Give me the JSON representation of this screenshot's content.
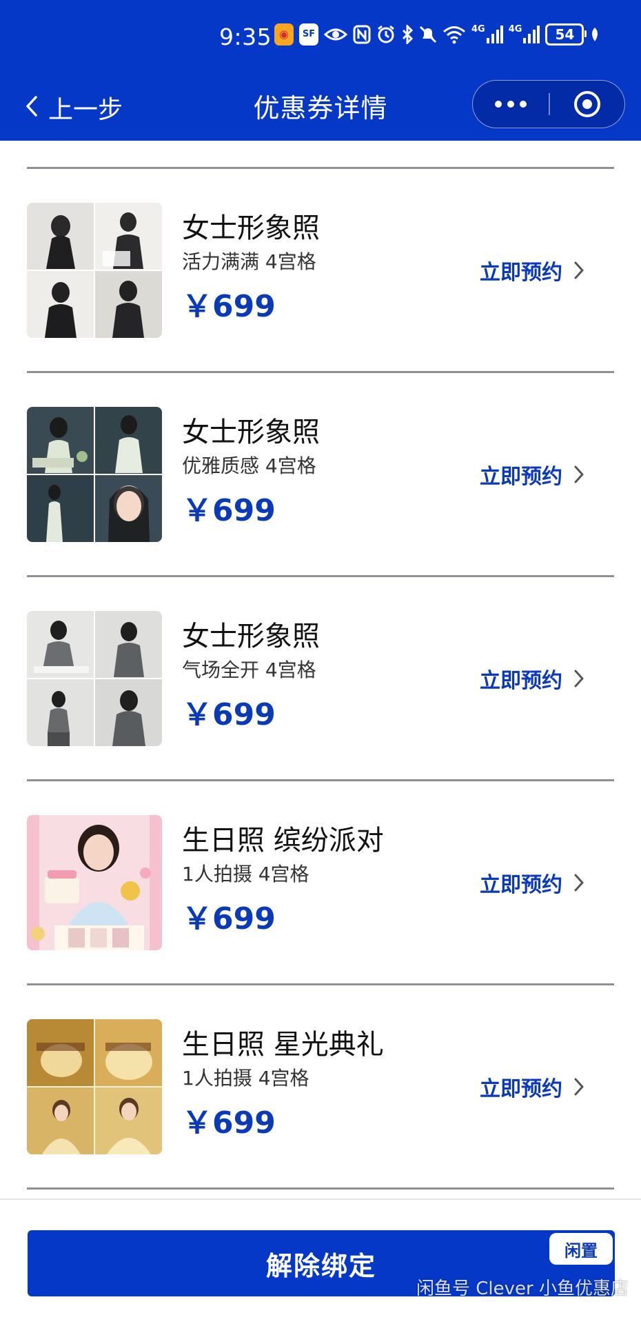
{
  "status_bar": {
    "time": "9:35",
    "network_1": "4G",
    "network_2": "4G",
    "battery": "54",
    "icons": [
      "weibo-icon",
      "sf-express-icon",
      "eye-icon",
      "nfc-icon",
      "alarm-icon",
      "bluetooth-icon",
      "mute-icon",
      "wifi-icon",
      "signal-icon",
      "signal-icon",
      "battery-icon",
      "leaf-icon"
    ]
  },
  "nav": {
    "back_label": "上一步",
    "title": "优惠券详情"
  },
  "items": [
    {
      "title": "女士形象照",
      "subtitle": "活力满满 4宫格",
      "price": "￥699",
      "action": "立即预约",
      "thumb_palette": [
        "#3b3b3b",
        "#e8e6e1",
        "#d9d4cb",
        "#2f2f32"
      ]
    },
    {
      "title": "女士形象照",
      "subtitle": "优雅质感 4宫格",
      "price": "￥699",
      "action": "立即预约",
      "thumb_palette": [
        "#3a4a50",
        "#c9d6c8",
        "#2d3b44",
        "#e7ece4"
      ]
    },
    {
      "title": "女士形象照",
      "subtitle": "气场全开 4宫格",
      "price": "￥699",
      "action": "立即预约",
      "thumb_palette": [
        "#e9e9e7",
        "#6a6d6e",
        "#d6d6d4",
        "#4d5052"
      ]
    },
    {
      "title": "生日照 缤纷派对",
      "subtitle": "1人拍摄 4宫格",
      "price": "￥699",
      "action": "立即预约",
      "thumb_palette": [
        "#f7d7de",
        "#f0b6c6",
        "#fbe9c9",
        "#c9e3f1"
      ]
    },
    {
      "title": "生日照 星光典礼",
      "subtitle": "1人拍摄 4宫格",
      "price": "￥699",
      "action": "立即预约",
      "thumb_palette": [
        "#c99a3e",
        "#e7c06a",
        "#f1dca0",
        "#a87a2c"
      ]
    }
  ],
  "bottom": {
    "button_label": "解除绑定",
    "corner_badge": "闲置",
    "watermark": "闲鱼号 Clever 小鱼优惠店"
  },
  "colors": {
    "brand_blue": "#0638c8",
    "price_blue": "#0a3ab8"
  }
}
